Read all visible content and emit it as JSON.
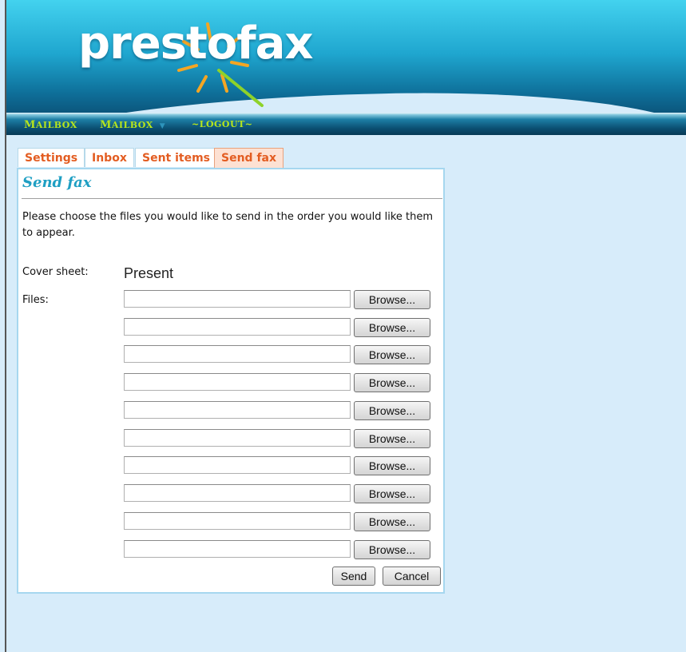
{
  "header": {
    "logo_text": "prestofax"
  },
  "nav": {
    "items": [
      {
        "cap": "M",
        "rest": "AILBOX"
      },
      {
        "cap": "M",
        "rest": "AILBOX"
      },
      {
        "cap": "",
        "rest": "~LOGOUT~"
      }
    ]
  },
  "tabs": [
    {
      "label": "Settings"
    },
    {
      "label": "Inbox"
    },
    {
      "label": "Sent items"
    },
    {
      "label": "Send fax"
    }
  ],
  "panel": {
    "title": "Send fax",
    "intro": "Please choose the files you would like to send in the order you would like them to appear.",
    "cover_label": "Cover sheet:",
    "cover_value": "Present",
    "files_label": "Files:",
    "browse_label": "Browse...",
    "file_values": [
      "",
      "",
      "",
      "",
      "",
      "",
      "",
      "",
      "",
      ""
    ],
    "send_label": "Send",
    "cancel_label": "Cancel"
  },
  "colors": {
    "accent_orange": "#e35d22",
    "title_blue": "#1f9fc3",
    "nav_green": "#b7e61c"
  }
}
